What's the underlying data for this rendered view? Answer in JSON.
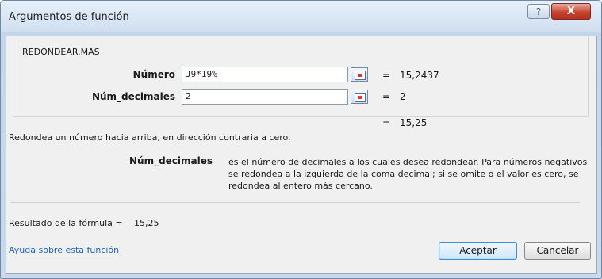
{
  "window": {
    "title": "Argumentos de función",
    "help_label": "?",
    "close_label": "X"
  },
  "function_name": "REDONDEAR.MAS",
  "arguments": [
    {
      "label": "Número",
      "value": "J9*19%",
      "result": "15,2437"
    },
    {
      "label": "Núm_decimales",
      "value": "2",
      "result": "2"
    }
  ],
  "equals_sign": "=",
  "function_result": "15,25",
  "description": "Redondea un número hacia arriba, en dirección contraria a cero.",
  "argument_help": {
    "label": "Núm_decimales",
    "text": "es el número de decimales a los cuales desea redondear. Para números negativos se redondea a la izquierda de la coma decimal; si se omite o el valor es cero, se redondea al entero más cercano."
  },
  "formula_result": {
    "label": "Resultado de la fórmula =",
    "value": "15,25"
  },
  "help_link": "Ayuda sobre esta función",
  "buttons": {
    "ok": "Aceptar",
    "cancel": "Cancelar"
  }
}
